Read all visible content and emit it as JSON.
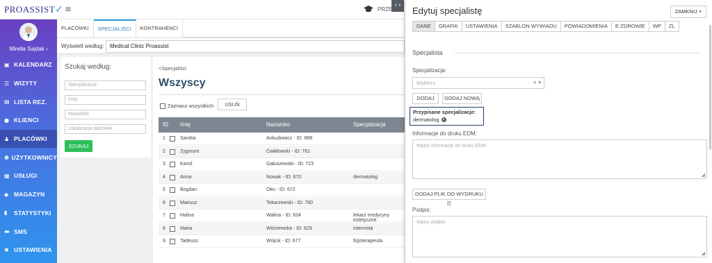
{
  "app": {
    "logo_text": "PROASSIST",
    "logo_check": "✓",
    "top_user": "PRZE"
  },
  "sidebar": {
    "profile_name": "Mirella Sajdak ›",
    "items": [
      {
        "label": "KALENDARZ",
        "icon": "calendar-icon",
        "glyph": "▣"
      },
      {
        "label": "WIZYTY",
        "icon": "list-icon",
        "glyph": "☰"
      },
      {
        "label": "LISTA REZ.",
        "icon": "book-icon",
        "glyph": "▤"
      },
      {
        "label": "KLIENCI",
        "icon": "users-icon",
        "glyph": "●"
      },
      {
        "label": "PLACÓWKI",
        "icon": "user-plus-icon",
        "glyph": "♟"
      },
      {
        "label": "UŻYTKOWNICY",
        "icon": "user-circle-icon",
        "glyph": "◉"
      },
      {
        "label": "USŁUGI",
        "icon": "grid-icon",
        "glyph": "▦"
      },
      {
        "label": "MAGAZYN",
        "icon": "box-icon",
        "glyph": "◆"
      },
      {
        "label": "STATYSTYKI",
        "icon": "bar-chart-icon",
        "glyph": "▮"
      },
      {
        "label": "SMS",
        "icon": "message-icon",
        "glyph": "▬"
      },
      {
        "label": "USTAWIENIA",
        "icon": "tools-icon",
        "glyph": "✖"
      }
    ]
  },
  "tabs": [
    "PLACÓWKI",
    "SPECJALIŚCI",
    "KONTRAHENCI"
  ],
  "filter": {
    "label": "Wyświetl według:",
    "value": "Medical Clinic Proassist"
  },
  "search": {
    "title": "Szukaj według:",
    "placeholders": [
      "Specjalizacja",
      "Imię",
      "Nazwisko",
      "Lokalizacja placówki"
    ],
    "button": "SZUKAJ"
  },
  "main": {
    "back": "<Specjaliści",
    "title": "Wszyscy",
    "select_all": "Zaznacz wszystkich",
    "delete_button": "USUŃ",
    "columns": [
      "ID",
      "Imię",
      "Nazwisko",
      "Specjalizacja"
    ],
    "rows": [
      {
        "id": "1",
        "first": "Sandra",
        "last": "Ankudowicz - ID: 889",
        "spec": ""
      },
      {
        "id": "2",
        "first": "Zygmunt",
        "last": "Ćwikłowski - ID: 761",
        "spec": ""
      },
      {
        "id": "3",
        "first": "Kamil",
        "last": "Gałuszewski - ID: 723",
        "spec": ""
      },
      {
        "id": "4",
        "first": "Anna",
        "last": "Nowak - ID: 670",
        "spec": "dermatolog"
      },
      {
        "id": "5",
        "first": "Bogdan",
        "last": "Oko - ID: 672",
        "spec": ""
      },
      {
        "id": "6",
        "first": "Mariusz",
        "last": "Tokarzewski - ID: 760",
        "spec": ""
      },
      {
        "id": "7",
        "first": "Halina",
        "last": "Walina - ID: 624",
        "spec": "lekarz medycyny estetyczne"
      },
      {
        "id": "8",
        "first": "Maria",
        "last": "Wiśniewska - ID: 629",
        "spec": "internista"
      },
      {
        "id": "9",
        "first": "Tadeusz",
        "last": "Wójcik - ID: 677",
        "spec": "fizjoterapeuta"
      }
    ]
  },
  "modal": {
    "title": "Edytuj specjalistę",
    "close_button": "ZAMKNIJ ×",
    "tabs": [
      "DANE",
      "GRAFIK",
      "USTAWIENIA",
      "SZABLON WYWIADU",
      "POWIADOMIENIA",
      "E-ZDROWIE",
      "WP",
      "ZL"
    ],
    "section": "Specjalista",
    "spec_label": "Specjalizacja:",
    "spec_placeholder": "Wybierz",
    "spec_controls": "× ▾",
    "add_button": "DODAJ",
    "add_new_button": "DODAJ NOWĄ",
    "assigned_label": "Przypisane specjalizacje:",
    "assigned_value": "dermatolog",
    "edm_label": "Informacje do druku EDM:",
    "edm_placeholder": "Wpisz informacje do druku EDM",
    "file_button": "DODAJ PLIK DO WYDRUKU ⎘",
    "signature_label": "Podpis:",
    "signature_placeholder": "Wpisz podpis"
  }
}
